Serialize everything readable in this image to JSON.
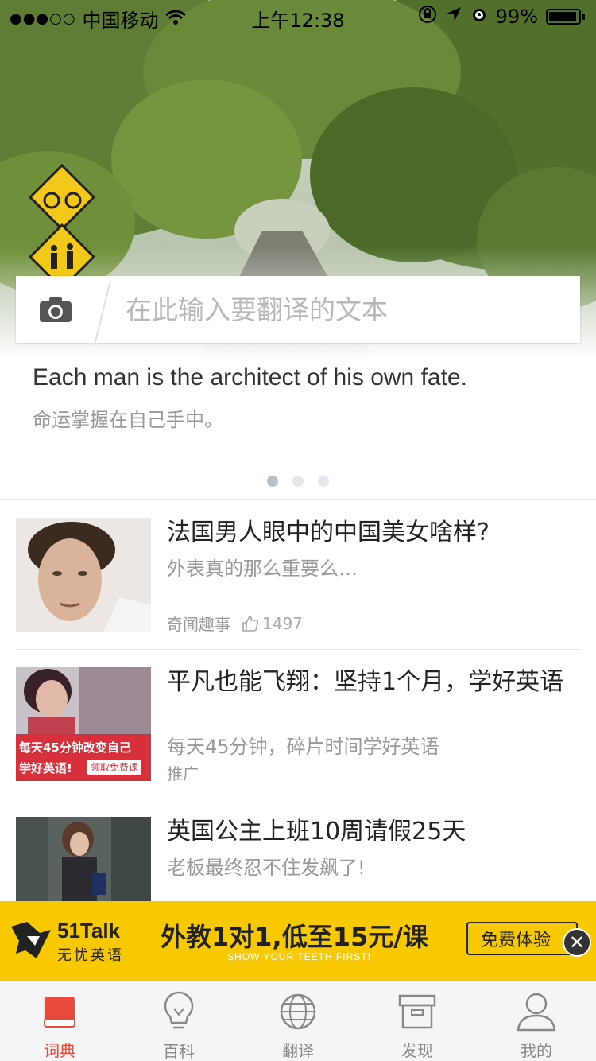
{
  "status_bar": {
    "carrier": "中国移动",
    "time": "上午12:38",
    "battery": "99%"
  },
  "search": {
    "placeholder": "在此输入要翻译的文本"
  },
  "quote": {
    "english": "Each man is the architect of his own fate.",
    "chinese": "命运掌握在自己手中。"
  },
  "articles": [
    {
      "title": "法国男人眼中的中国美女啥样?",
      "subtitle": "外表真的那么重要么…",
      "category": "奇闻趣事",
      "likes": "1497"
    },
    {
      "title": "平凡也能飞翔：坚持1个月，学好英语",
      "subtitle": "每天45分钟，碎片时间学好英语",
      "category": "推广",
      "thumb_line1": "每天45分钟改变自己",
      "thumb_line2": "学好英语!",
      "thumb_button": "领取免费课"
    },
    {
      "title": "英国公主上班10周请假25天",
      "subtitle": "老板最终忍不住发飙了!"
    }
  ],
  "ad": {
    "brand": "51Talk",
    "brand_sub": "无忧英语",
    "slogan": "外教1对1,低至15元/课",
    "slogan_en": "SHOW YOUR TEETH FIRST!",
    "button": "免费体验"
  },
  "tabs": [
    {
      "label": "词典",
      "icon": "book-icon",
      "active": true
    },
    {
      "label": "百科",
      "icon": "lightbulb-icon"
    },
    {
      "label": "翻译",
      "icon": "globe-icon"
    },
    {
      "label": "发现",
      "icon": "box-icon"
    },
    {
      "label": "我的",
      "icon": "user-icon"
    }
  ],
  "colors": {
    "accent": "#e8493c",
    "ad_background": "#f9c900"
  }
}
